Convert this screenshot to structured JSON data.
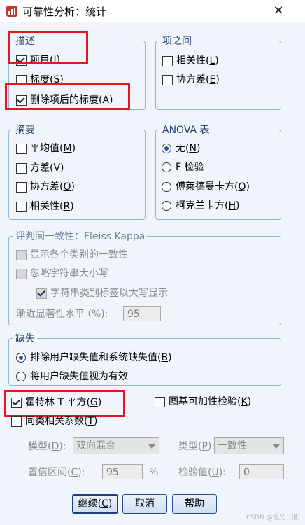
{
  "window": {
    "title": "可靠性分析：统计",
    "close_symbol": "✕"
  },
  "descriptives": {
    "label": "描述",
    "item": {
      "label": "项目",
      "key": "I",
      "checked": true
    },
    "scale": {
      "label": "标度",
      "key": "S",
      "checked": false
    },
    "scale_if_deleted": {
      "label": "删除项后的标度",
      "key": "A",
      "checked": true
    }
  },
  "inter_item": {
    "label": "项之间",
    "correlations": {
      "label": "相关性",
      "key": "L",
      "checked": false
    },
    "covariances": {
      "label": "协方差",
      "key": "E",
      "checked": false
    }
  },
  "summaries": {
    "label": "摘要",
    "means": {
      "label": "平均值",
      "key": "M",
      "checked": false
    },
    "variances": {
      "label": "方差",
      "key": "V",
      "checked": false
    },
    "covariances": {
      "label": "协方差",
      "key": "O",
      "checked": false
    },
    "correlations": {
      "label": "相关性",
      "key": "R",
      "checked": false
    }
  },
  "anova": {
    "label": "ANOVA 表",
    "none": {
      "label": "无",
      "key": "N",
      "selected": true
    },
    "f_test": {
      "label": "F 检验",
      "key": "F",
      "selected": false
    },
    "friedman": {
      "label": "傅莱德曼卡方",
      "key": "Q",
      "selected": false
    },
    "cochran": {
      "label": "柯克兰卡方",
      "key": "H",
      "selected": false
    }
  },
  "fleiss": {
    "label": "评判间一致性：Fleiss Kappa",
    "show_agreement": "显示各个类别的一致性",
    "ignore_case": "忽略字符串大小写",
    "uppercase_labels": "字符串类别标签以大写显示",
    "asymptotic_label": "渐近显著性水平 (%):",
    "asymptotic_value": "95"
  },
  "missing": {
    "label": "缺失",
    "exclude": {
      "label": "排除用户缺失值和系统缺失值",
      "key": "B",
      "selected": true
    },
    "valid": {
      "label": "将用户缺失值视为有效",
      "selected": false
    }
  },
  "hotelling": {
    "label": "霍特林 T 平方",
    "key": "G",
    "checked": true
  },
  "tukey": {
    "label": "图基可加性检验",
    "key": "K",
    "checked": false
  },
  "icc": {
    "label": "同类相关系数",
    "key": "T",
    "checked": false,
    "model_label": "模型",
    "model_key": "D",
    "model_value": "双向混合",
    "type_label": "类型",
    "type_key": "P",
    "type_value": "一致性",
    "ci_label": "置信区间",
    "ci_key": "C",
    "ci_value": "95",
    "percent": "%",
    "test_label": "检验值",
    "test_key": "U",
    "test_value": "0"
  },
  "buttons": {
    "continue": {
      "label": "继续",
      "key": "C"
    },
    "cancel": {
      "label": "取消"
    },
    "help": {
      "label": "帮助"
    }
  },
  "watermark": "CSDN @含光（退）"
}
